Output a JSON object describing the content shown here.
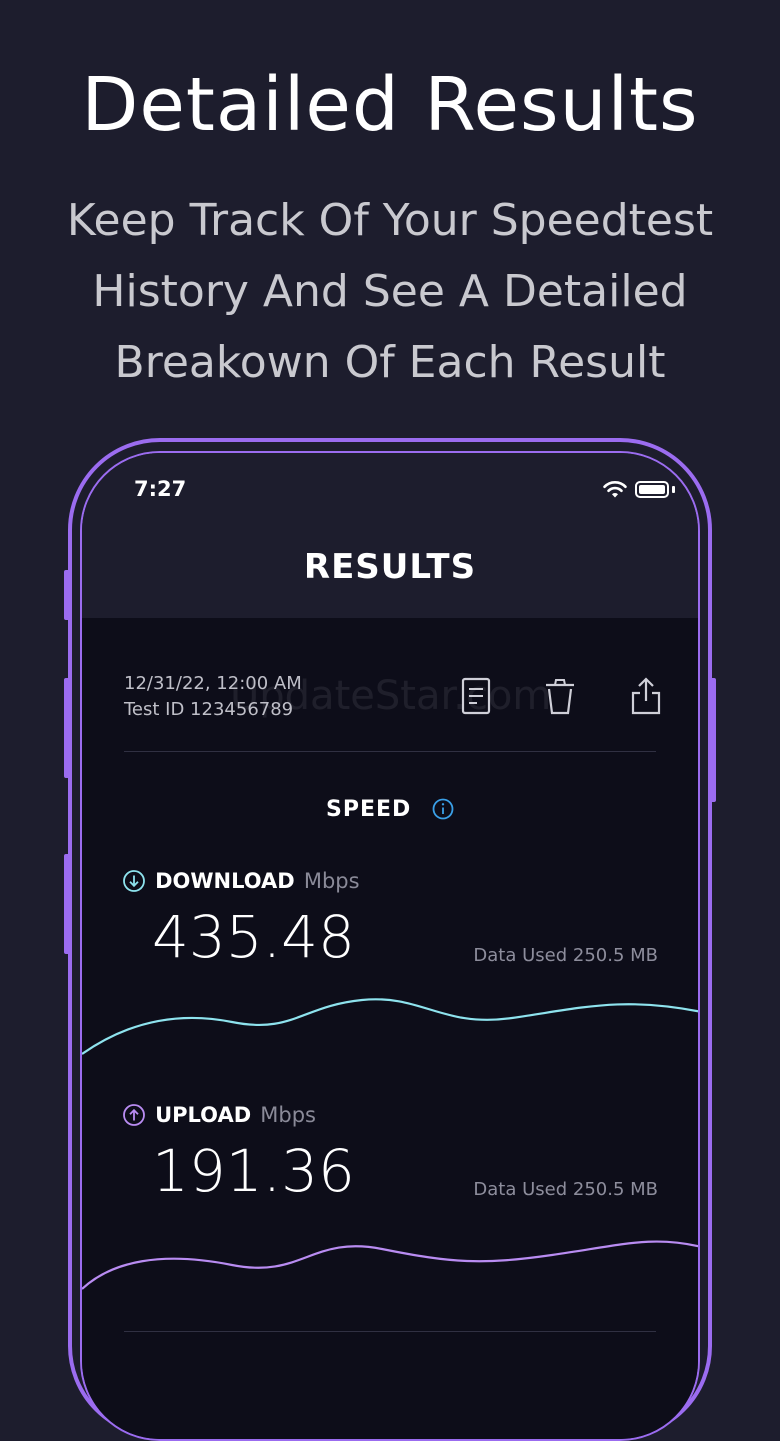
{
  "headline": "Detailed Results",
  "subhead": {
    "line1": "Keep Track Of Your Speedtest",
    "line2": "History And See A Detailed",
    "line3": "Breakown Of Each Result"
  },
  "status_bar": {
    "time": "7:27",
    "icons": [
      "wifi-icon",
      "battery-icon"
    ]
  },
  "screen": {
    "title": "RESULTS",
    "test": {
      "date": "12/31/22, 12:00 AM",
      "id": "Test ID 123456789"
    },
    "watermark": "UpdateStar.com",
    "actions": [
      "document-icon",
      "trash-icon",
      "share-icon"
    ],
    "speed_section": {
      "heading": "SPEED",
      "info_icon": "info-icon",
      "download": {
        "label": "DOWNLOAD",
        "unit": "Mbps",
        "value": "435.48",
        "data_used": "Data Used 250.5 MB",
        "color": "#8ee3ee"
      },
      "upload": {
        "label": "UPLOAD",
        "unit": "Mbps",
        "value": "191.36",
        "data_used": "Data Used 250.5 MB",
        "color": "#b98cf2"
      }
    }
  },
  "colors": {
    "background": "#1d1d2d",
    "phone_frame": "#9b6cf0",
    "screen_body": "#0d0d19",
    "info_accent": "#3aa0e8"
  }
}
